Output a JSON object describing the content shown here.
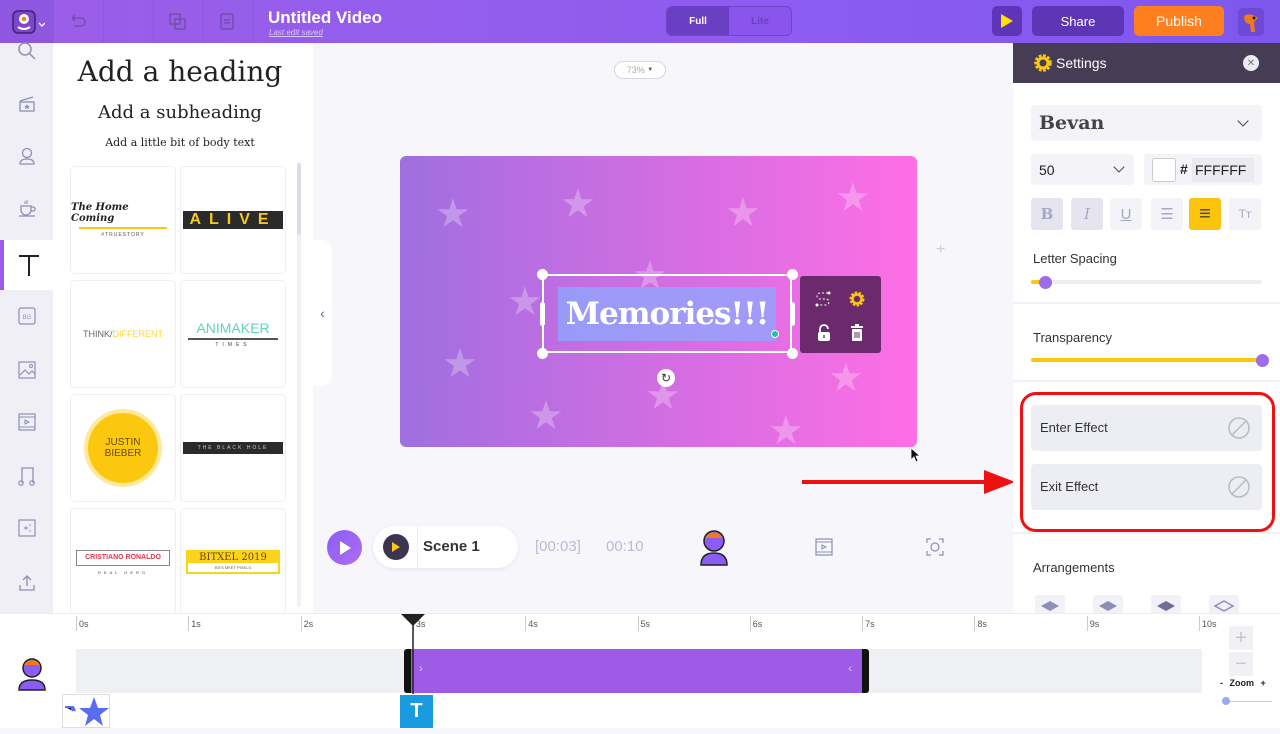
{
  "app": {
    "title": "Untitled Video",
    "subtitle": "Last edit saved"
  },
  "toolbar": {
    "mode_full": "Full",
    "mode_lite": "Lite",
    "share_label": "Share",
    "publish_label": "Publish",
    "icons": [
      "undo-icon",
      "redo-icon",
      "duplicate-icon",
      "clipboard-icon"
    ]
  },
  "rail": {
    "items": [
      {
        "name": "search",
        "icon": "search-icon"
      },
      {
        "name": "scenes",
        "icon": "clapboard-icon"
      },
      {
        "name": "characters",
        "icon": "character-icon"
      },
      {
        "name": "props",
        "icon": "coffee-cup-icon"
      },
      {
        "name": "text",
        "icon": "text-icon",
        "active": true
      },
      {
        "name": "backgrounds",
        "icon": "bg-icon",
        "label": "BG"
      },
      {
        "name": "images",
        "icon": "image-icon"
      },
      {
        "name": "video",
        "icon": "video-icon"
      },
      {
        "name": "music",
        "icon": "music-icon"
      },
      {
        "name": "effects",
        "icon": "effects-icon"
      },
      {
        "name": "upload",
        "icon": "upload-icon"
      }
    ]
  },
  "text_panel": {
    "heading": "Add a heading",
    "subheading": "Add a subheading",
    "body": "Add a little bit of body text",
    "templates": [
      {
        "title": "The Home Coming",
        "sub": "#TRUESTORY"
      },
      {
        "title": "ALIVE"
      },
      {
        "title": "THINK/",
        "title2": "DIFFERENT"
      },
      {
        "title": "ANIMAKER",
        "sub": "TIMES"
      },
      {
        "title": "JUSTIN",
        "title2": "BIEBER"
      },
      {
        "title": "THE BLACK HOLE"
      },
      {
        "title": "CRISTIANO RONALDO",
        "sub": "REAL HERO"
      },
      {
        "title": "BITXEL 2019",
        "sub": "BITS MEET PIXELS"
      }
    ]
  },
  "canvas": {
    "zoom": "73%",
    "text": "Memories!!!",
    "colors": {
      "gradient_start": "#9f6fe0",
      "gradient_end": "#fe6ee5"
    }
  },
  "playback": {
    "scene_name": "Scene 1",
    "current_time": "[00:03]",
    "total_time": "00:10"
  },
  "settings": {
    "title": "Settings",
    "font": "Bevan",
    "font_size": "50",
    "hash": "#",
    "color_hex": "FFFFFF",
    "format_buttons": [
      {
        "label": "B",
        "name": "bold"
      },
      {
        "label": "I",
        "name": "italic"
      },
      {
        "label": "U",
        "name": "underline"
      },
      {
        "label": "☰",
        "name": "list"
      },
      {
        "label": "≡",
        "name": "align-center",
        "active": true
      },
      {
        "label": "Tт",
        "name": "text-case"
      }
    ],
    "letter_spacing_label": "Letter Spacing",
    "letter_spacing_value": 0.06,
    "transparency_label": "Transparency",
    "transparency_value": 1.0,
    "enter_effect": "Enter Effect",
    "exit_effect": "Exit Effect",
    "arrangements_label": "Arrangements"
  },
  "timeline": {
    "ticks": [
      "0s",
      "1s",
      "2s",
      "3s",
      "4s",
      "5s",
      "6s",
      "7s",
      "8s",
      "9s",
      "10s"
    ],
    "playhead_seconds": 3,
    "clip_start_seconds": 3,
    "clip_end_seconds": 7,
    "text_chip": "T",
    "zoom_label": "- Zoom +",
    "zoom_plus": "+",
    "zoom_minus": "−"
  }
}
